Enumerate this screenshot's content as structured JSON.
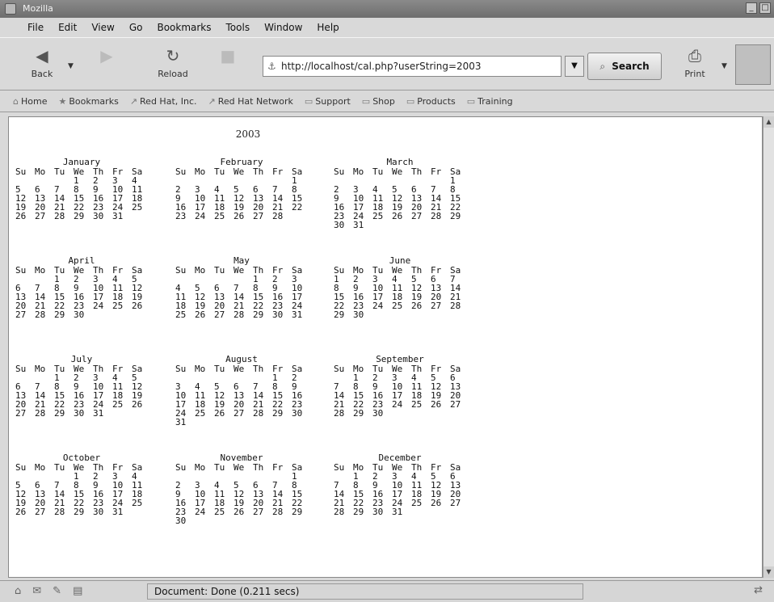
{
  "window": {
    "title": "Mozilla"
  },
  "menu": [
    "File",
    "Edit",
    "View",
    "Go",
    "Bookmarks",
    "Tools",
    "Window",
    "Help"
  ],
  "toolbar": {
    "back": "Back",
    "forward": "Forward",
    "reload": "Reload",
    "stop": "Stop",
    "url": "http://localhost/cal.php?userString=2003",
    "search": "Search",
    "print": "Print"
  },
  "bookmarks": [
    "Home",
    "Bookmarks",
    "Red Hat, Inc.",
    "Red Hat Network",
    "Support",
    "Shop",
    "Products",
    "Training"
  ],
  "calendar": {
    "year": "2003",
    "weekdays": [
      "Su",
      "Mo",
      "Tu",
      "We",
      "Th",
      "Fr",
      "Sa"
    ],
    "months": [
      {
        "name": "January",
        "weeks": [
          [
            "",
            "",
            "",
            "1",
            "2",
            "3",
            "4"
          ],
          [
            "5",
            "6",
            "7",
            "8",
            "9",
            "10",
            "11"
          ],
          [
            "12",
            "13",
            "14",
            "15",
            "16",
            "17",
            "18"
          ],
          [
            "19",
            "20",
            "21",
            "22",
            "23",
            "24",
            "25"
          ],
          [
            "26",
            "27",
            "28",
            "29",
            "30",
            "31",
            ""
          ]
        ]
      },
      {
        "name": "February",
        "weeks": [
          [
            "",
            "",
            "",
            "",
            "",
            "",
            "1"
          ],
          [
            "2",
            "3",
            "4",
            "5",
            "6",
            "7",
            "8"
          ],
          [
            "9",
            "10",
            "11",
            "12",
            "13",
            "14",
            "15"
          ],
          [
            "16",
            "17",
            "18",
            "19",
            "20",
            "21",
            "22"
          ],
          [
            "23",
            "24",
            "25",
            "26",
            "27",
            "28",
            ""
          ]
        ]
      },
      {
        "name": "March",
        "weeks": [
          [
            "",
            "",
            "",
            "",
            "",
            "",
            "1"
          ],
          [
            "2",
            "3",
            "4",
            "5",
            "6",
            "7",
            "8"
          ],
          [
            "9",
            "10",
            "11",
            "12",
            "13",
            "14",
            "15"
          ],
          [
            "16",
            "17",
            "18",
            "19",
            "20",
            "21",
            "22"
          ],
          [
            "23",
            "24",
            "25",
            "26",
            "27",
            "28",
            "29"
          ],
          [
            "30",
            "31",
            "",
            "",
            "",
            "",
            ""
          ]
        ]
      },
      {
        "name": "April",
        "weeks": [
          [
            "",
            "",
            "1",
            "2",
            "3",
            "4",
            "5"
          ],
          [
            "6",
            "7",
            "8",
            "9",
            "10",
            "11",
            "12"
          ],
          [
            "13",
            "14",
            "15",
            "16",
            "17",
            "18",
            "19"
          ],
          [
            "20",
            "21",
            "22",
            "23",
            "24",
            "25",
            "26"
          ],
          [
            "27",
            "28",
            "29",
            "30",
            "",
            "",
            ""
          ]
        ]
      },
      {
        "name": "May",
        "weeks": [
          [
            "",
            "",
            "",
            "",
            "1",
            "2",
            "3"
          ],
          [
            "4",
            "5",
            "6",
            "7",
            "8",
            "9",
            "10"
          ],
          [
            "11",
            "12",
            "13",
            "14",
            "15",
            "16",
            "17"
          ],
          [
            "18",
            "19",
            "20",
            "21",
            "22",
            "23",
            "24"
          ],
          [
            "25",
            "26",
            "27",
            "28",
            "29",
            "30",
            "31"
          ]
        ]
      },
      {
        "name": "June",
        "weeks": [
          [
            "1",
            "2",
            "3",
            "4",
            "5",
            "6",
            "7"
          ],
          [
            "8",
            "9",
            "10",
            "11",
            "12",
            "13",
            "14"
          ],
          [
            "15",
            "16",
            "17",
            "18",
            "19",
            "20",
            "21"
          ],
          [
            "22",
            "23",
            "24",
            "25",
            "26",
            "27",
            "28"
          ],
          [
            "29",
            "30",
            "",
            "",
            "",
            "",
            ""
          ]
        ]
      },
      {
        "name": "July",
        "weeks": [
          [
            "",
            "",
            "1",
            "2",
            "3",
            "4",
            "5"
          ],
          [
            "6",
            "7",
            "8",
            "9",
            "10",
            "11",
            "12"
          ],
          [
            "13",
            "14",
            "15",
            "16",
            "17",
            "18",
            "19"
          ],
          [
            "20",
            "21",
            "22",
            "23",
            "24",
            "25",
            "26"
          ],
          [
            "27",
            "28",
            "29",
            "30",
            "31",
            "",
            ""
          ]
        ]
      },
      {
        "name": "August",
        "weeks": [
          [
            "",
            "",
            "",
            "",
            "",
            "1",
            "2"
          ],
          [
            "3",
            "4",
            "5",
            "6",
            "7",
            "8",
            "9"
          ],
          [
            "10",
            "11",
            "12",
            "13",
            "14",
            "15",
            "16"
          ],
          [
            "17",
            "18",
            "19",
            "20",
            "21",
            "22",
            "23"
          ],
          [
            "24",
            "25",
            "26",
            "27",
            "28",
            "29",
            "30"
          ],
          [
            "31",
            "",
            "",
            "",
            "",
            "",
            ""
          ]
        ]
      },
      {
        "name": "September",
        "weeks": [
          [
            "",
            "1",
            "2",
            "3",
            "4",
            "5",
            "6"
          ],
          [
            "7",
            "8",
            "9",
            "10",
            "11",
            "12",
            "13"
          ],
          [
            "14",
            "15",
            "16",
            "17",
            "18",
            "19",
            "20"
          ],
          [
            "21",
            "22",
            "23",
            "24",
            "25",
            "26",
            "27"
          ],
          [
            "28",
            "29",
            "30",
            "",
            "",
            "",
            ""
          ]
        ]
      },
      {
        "name": "October",
        "weeks": [
          [
            "",
            "",
            "",
            "1",
            "2",
            "3",
            "4"
          ],
          [
            "5",
            "6",
            "7",
            "8",
            "9",
            "10",
            "11"
          ],
          [
            "12",
            "13",
            "14",
            "15",
            "16",
            "17",
            "18"
          ],
          [
            "19",
            "20",
            "21",
            "22",
            "23",
            "24",
            "25"
          ],
          [
            "26",
            "27",
            "28",
            "29",
            "30",
            "31",
            ""
          ]
        ]
      },
      {
        "name": "November",
        "weeks": [
          [
            "",
            "",
            "",
            "",
            "",
            "",
            "1"
          ],
          [
            "2",
            "3",
            "4",
            "5",
            "6",
            "7",
            "8"
          ],
          [
            "9",
            "10",
            "11",
            "12",
            "13",
            "14",
            "15"
          ],
          [
            "16",
            "17",
            "18",
            "19",
            "20",
            "21",
            "22"
          ],
          [
            "23",
            "24",
            "25",
            "26",
            "27",
            "28",
            "29"
          ],
          [
            "30",
            "",
            "",
            "",
            "",
            "",
            ""
          ]
        ]
      },
      {
        "name": "December",
        "weeks": [
          [
            "",
            "1",
            "2",
            "3",
            "4",
            "5",
            "6"
          ],
          [
            "7",
            "8",
            "9",
            "10",
            "11",
            "12",
            "13"
          ],
          [
            "14",
            "15",
            "16",
            "17",
            "18",
            "19",
            "20"
          ],
          [
            "21",
            "22",
            "23",
            "24",
            "25",
            "26",
            "27"
          ],
          [
            "28",
            "29",
            "30",
            "31",
            "",
            "",
            ""
          ]
        ]
      }
    ]
  },
  "status": {
    "text": "Document: Done (0.211 secs)"
  }
}
